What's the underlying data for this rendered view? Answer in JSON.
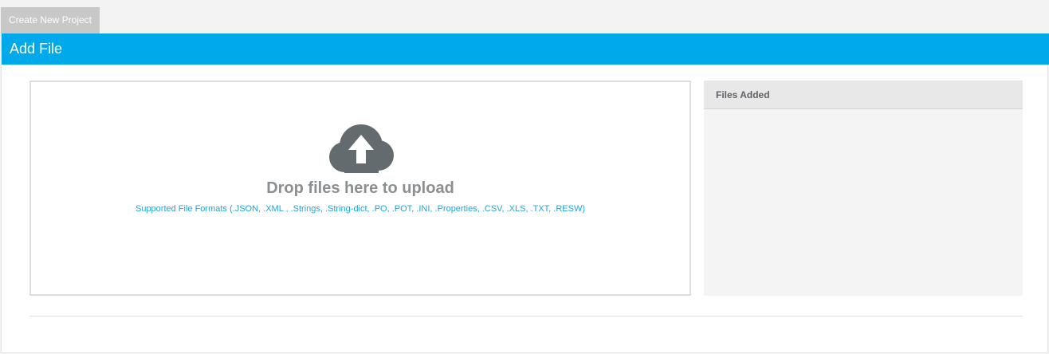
{
  "tabs": {
    "create_project_label": "Create New Project"
  },
  "panel": {
    "title": "Add File",
    "header_color": "#00a9ea"
  },
  "dropzone": {
    "icon": "cloud-upload-icon",
    "title": "Drop files here to upload",
    "formats": "Supported File Formats (.JSON, .XML , .Strings, .String-dict, .PO, .POT, .INI, .Properties, .CSV, .XLS, .TXT, .RESW)"
  },
  "files_added": {
    "title": "Files Added",
    "items": []
  }
}
